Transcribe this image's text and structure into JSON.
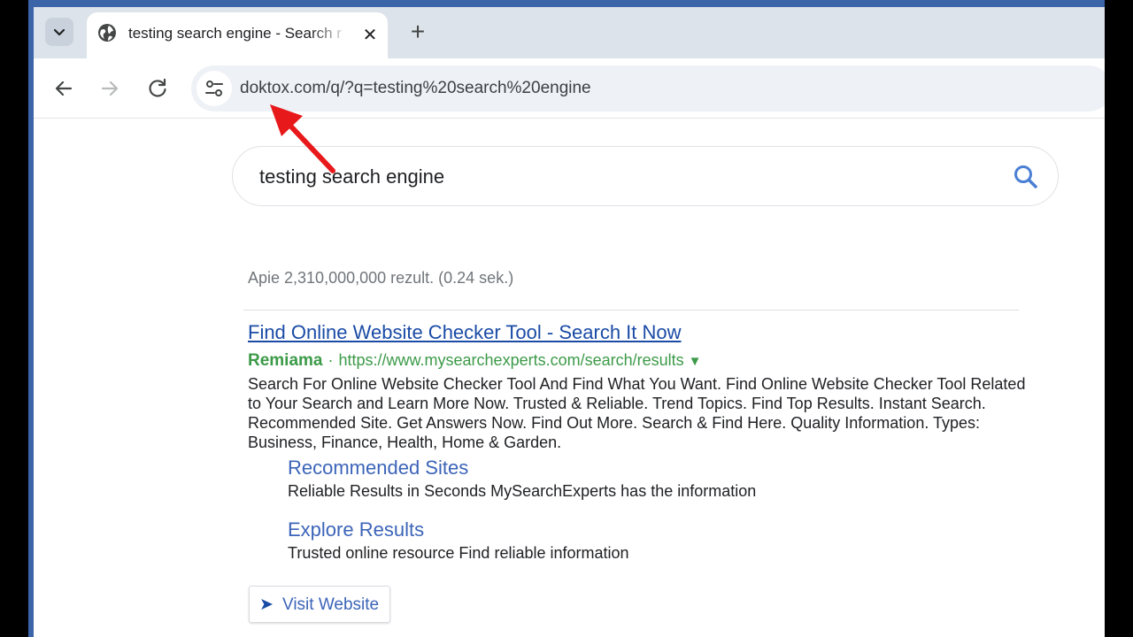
{
  "tab": {
    "title": "testing search engine - Search r",
    "close_symbol": "✕",
    "new_tab_symbol": "+"
  },
  "toolbar": {
    "url": "doktox.com/q/?q=testing%20search%20engine"
  },
  "search": {
    "query": "testing search engine",
    "result_count": "Apie 2,310,000,000 rezult. (0.24 sek.)"
  },
  "ad": {
    "title": "Find Online Website Checker Tool - Search It Now",
    "brand": "Remiama",
    "separator": "·",
    "url": "https://www.mysearchexperts.com/search/results",
    "dropdown": "▼",
    "description": "Search For Online Website Checker Tool And Find What You Want. Find Online Website Checker Tool Related to Your Search and Learn More Now. Trusted & Reliable. Trend Topics. Find Top Results. Instant Search. Recommended Site. Get Answers Now. Find Out More. Search & Find Here. Quality Information. Types: Business, Finance, Health, Home & Garden.",
    "sitelinks": [
      {
        "title": "Recommended Sites",
        "desc": "Reliable Results in Seconds MySearchExperts has the information"
      },
      {
        "title": "Explore Results",
        "desc": "Trusted online resource Find reliable information"
      }
    ],
    "visit_button": {
      "arrow": "➤",
      "label": "Visit Website"
    }
  },
  "icons": {
    "tab_search": "chevron-down-icon",
    "tab_favicon": "globe-icon",
    "back": "arrow-left-icon",
    "forward": "arrow-right-icon",
    "reload": "reload-icon",
    "site_info": "tune-icon",
    "search": "search-icon",
    "annotation": "red-arrow-icon"
  },
  "colors": {
    "frame": "#3c64a8",
    "link": "#1a4ba6",
    "ad_green": "#3c9a48",
    "annotation_red": "#e8191b"
  }
}
